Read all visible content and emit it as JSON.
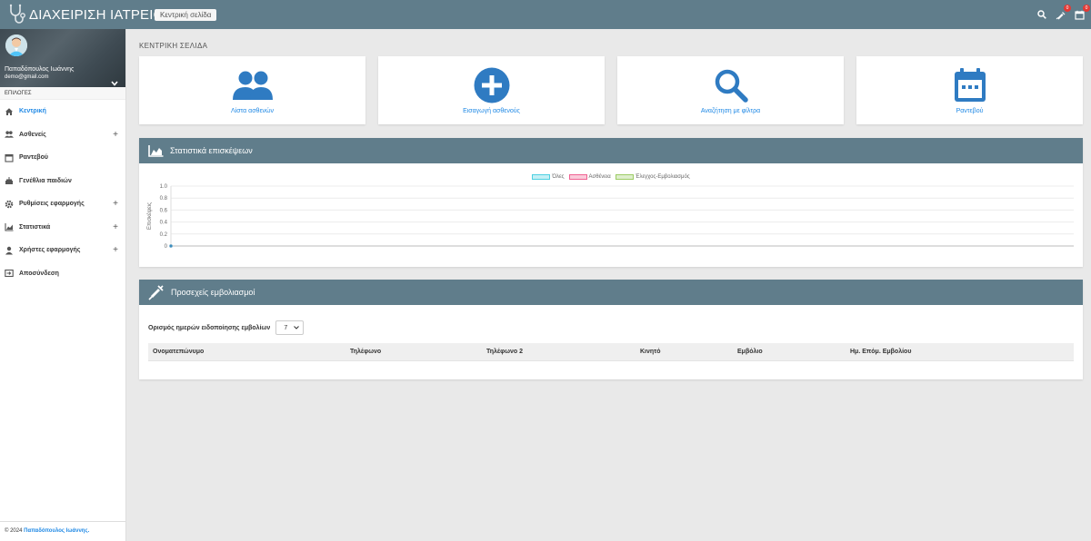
{
  "app": {
    "title": "ΔΙΑΧΕΙΡΙΣΗ ΙΑΤΡΕΙΟΥ",
    "home_badge": "Κεντρική σελίδα",
    "notifications": {
      "vaccines": "0",
      "calendar": "0"
    }
  },
  "user": {
    "name": "Παπαδόπουλος Ιωάννης",
    "email": "demo@gmail.com"
  },
  "sidebar": {
    "options_label": "ΕΠΙΛΟΓΕΣ",
    "items": [
      {
        "label": "Κεντρική",
        "icon": "home-icon",
        "expandable": false,
        "active": true
      },
      {
        "label": "Ασθενείς",
        "icon": "users-icon",
        "expandable": true,
        "active": false
      },
      {
        "label": "Ραντεβού",
        "icon": "calendar-icon",
        "expandable": false,
        "active": false
      },
      {
        "label": "Γενέθλια παιδιών",
        "icon": "cake-icon",
        "expandable": false,
        "active": false
      },
      {
        "label": "Ρυθμίσεις εφαρμογής",
        "icon": "gear-icon",
        "expandable": true,
        "active": false
      },
      {
        "label": "Στατιστικά",
        "icon": "chart-icon",
        "expandable": true,
        "active": false
      },
      {
        "label": "Χρήστες εφαρμογής",
        "icon": "user-icon",
        "expandable": true,
        "active": false
      },
      {
        "label": "Αποσύνδεση",
        "icon": "logout-icon",
        "expandable": false,
        "active": false
      }
    ],
    "footer_prefix": "© 2024",
    "footer_author": "Παπαδόπουλος Ιωάννης."
  },
  "main": {
    "page_title": "ΚΕΝΤΡΙΚΗ ΣΕΛΙΔΑ",
    "cards": [
      {
        "label": "Λίστα ασθενών",
        "icon": "users-icon"
      },
      {
        "label": "Εισαγωγή ασθενούς",
        "icon": "plus-circle-icon"
      },
      {
        "label": "Αναζήτηση με φίλτρα",
        "icon": "search-icon"
      },
      {
        "label": "Ραντεβού",
        "icon": "calendar-icon"
      }
    ],
    "stats_panel": {
      "title": "Στατιστικά επισκέψεων"
    },
    "vaccines_panel": {
      "title": "Προσεχείς εμβολιασμοί",
      "filter_label": "Ορισμός ημερών ειδοποίησης εμβολίων",
      "filter_value": "7",
      "columns": [
        "Ονοματεπώνυμο",
        "Τηλέφωνο",
        "Τηλέφωνο 2",
        "Κινητό",
        "Εμβόλιο",
        "Ημ. Επόμ. Εμβολίου"
      ]
    }
  },
  "colors": {
    "topbar": "#607d8b",
    "accent": "#1e88e5",
    "card_icon": "#2f7bc2",
    "badge": "#e53935"
  },
  "chart_data": {
    "type": "line",
    "ylabel": "Επισκέψεις",
    "ylim": [
      0,
      1.0
    ],
    "yticks": [
      "0",
      "0.2",
      "0.4",
      "0.6",
      "0.8",
      "1.0"
    ],
    "legend_position": "top-center",
    "grid": true,
    "series": [
      {
        "name": "Όλες",
        "color": "#4dd0e1",
        "values": [
          0
        ]
      },
      {
        "name": "Ασθένεια",
        "color": "#f06292",
        "values": [
          0
        ]
      },
      {
        "name": "Έλεγχος-Εμβολιασμός",
        "color": "#9ccc65",
        "values": [
          0
        ]
      }
    ]
  }
}
